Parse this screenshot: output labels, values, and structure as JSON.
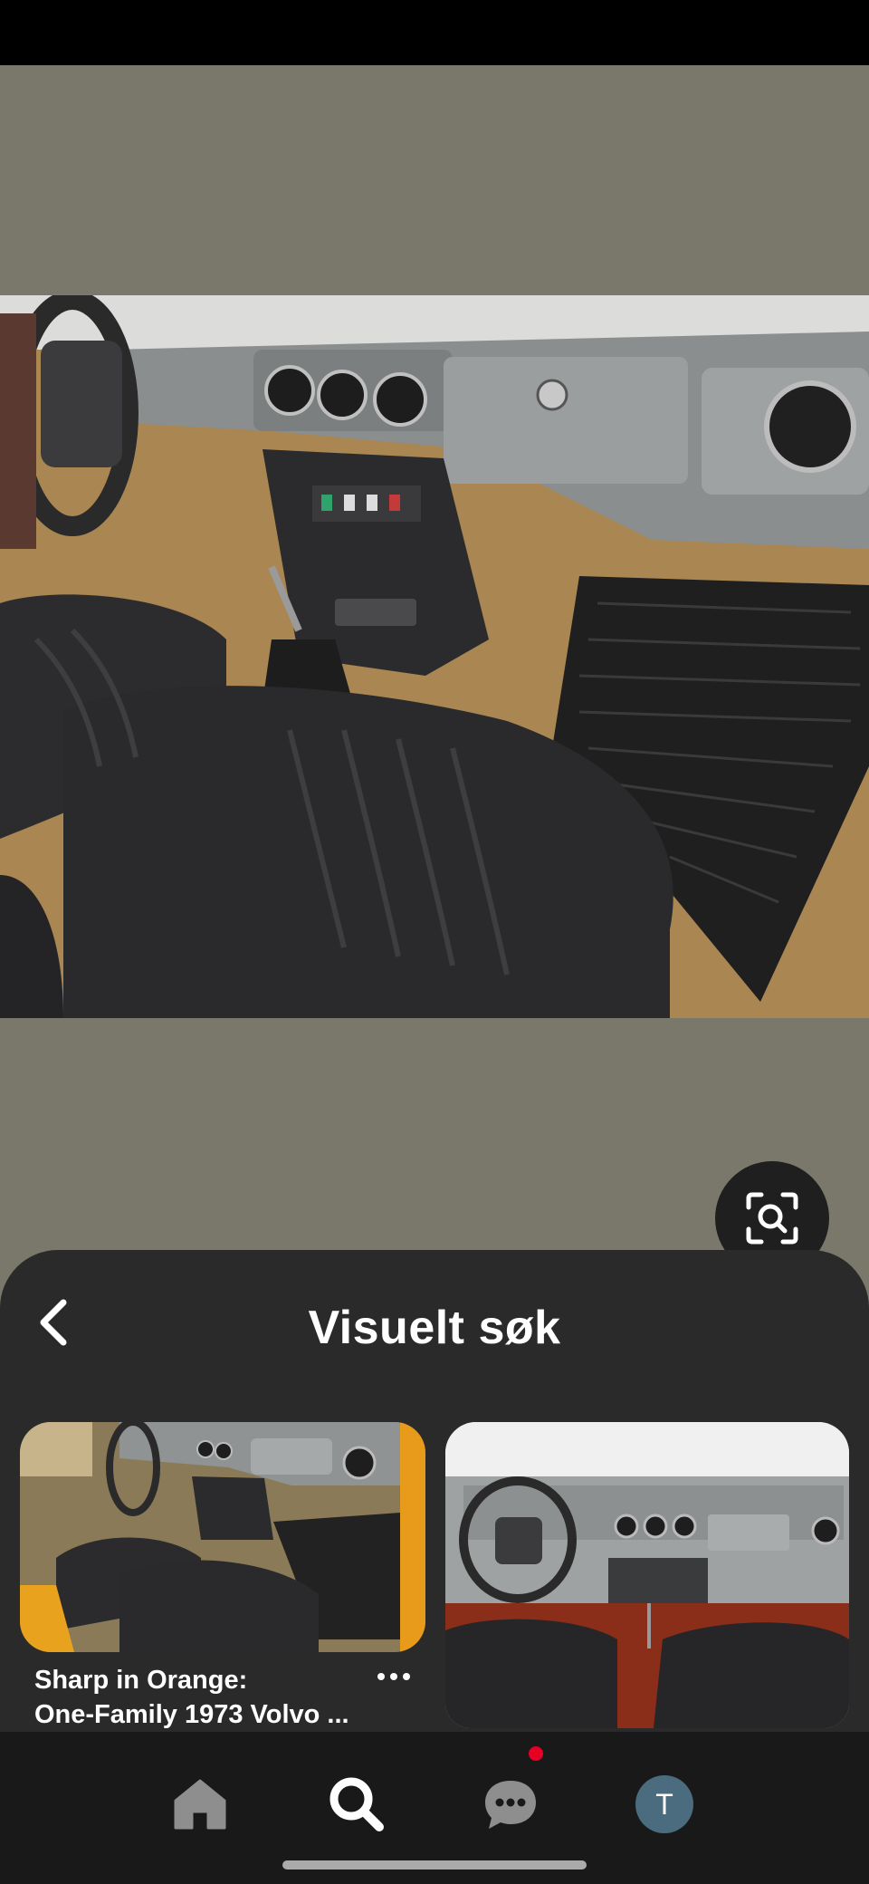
{
  "screen": {
    "background": "#79786a"
  },
  "pin": {
    "image_subject": "1973 Volvo interior with black leather seats and grey dashboard"
  },
  "lens": {
    "icon": "visual-search-lens-icon"
  },
  "sheet": {
    "title": "Visuelt søk",
    "back_icon": "chevron-left-icon",
    "results": [
      {
        "caption_line1": "Sharp in Orange:",
        "caption_line2": "One-Family 1973 Volvo ...",
        "more_icon": "more-dots-icon"
      },
      {
        "caption_line1": "",
        "caption_line2": ""
      }
    ]
  },
  "nav": {
    "items": [
      {
        "name": "home",
        "icon": "home-icon"
      },
      {
        "name": "search",
        "icon": "search-icon",
        "active": true
      },
      {
        "name": "messages",
        "icon": "chat-bubble-icon",
        "has_notification": true
      },
      {
        "name": "profile",
        "avatar_letter": "T"
      }
    ],
    "accent": "#e60023"
  }
}
